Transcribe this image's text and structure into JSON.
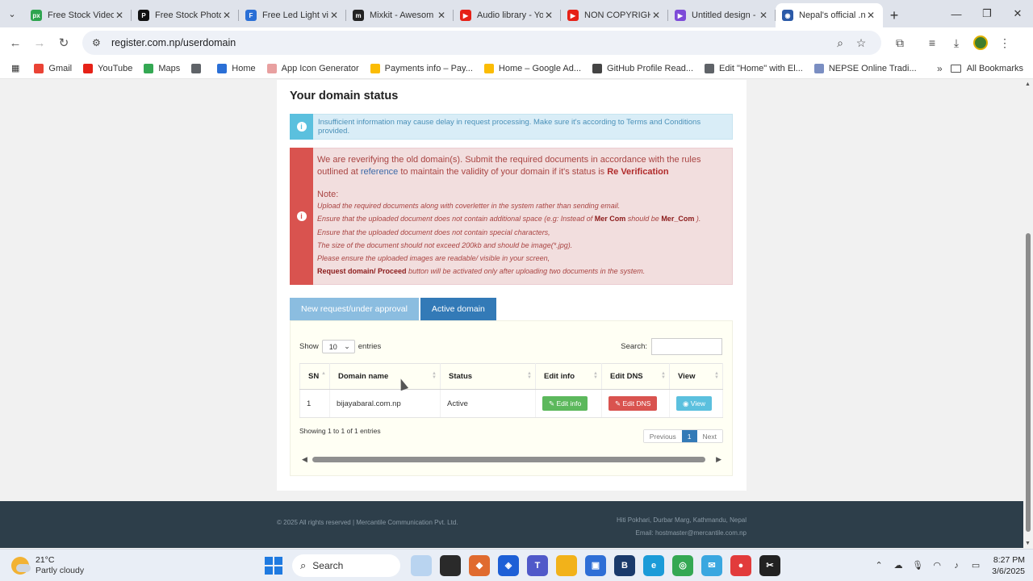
{
  "browser": {
    "tabs": [
      {
        "title": "Free Stock Video",
        "icon_color": "#2ea44f",
        "icon_glyph": "px"
      },
      {
        "title": "Free Stock Photo",
        "icon_color": "#111111",
        "icon_glyph": "P"
      },
      {
        "title": "Free Led Light vi",
        "icon_color": "#2a6fd6",
        "icon_glyph": "F"
      },
      {
        "title": "Mixkit - Awesom",
        "icon_color": "#222222",
        "icon_glyph": "m"
      },
      {
        "title": "Audio library - Yo",
        "icon_color": "#e62117",
        "icon_glyph": "▶"
      },
      {
        "title": "NON COPYRIGH",
        "icon_color": "#e62117",
        "icon_glyph": "▶"
      },
      {
        "title": "Untitled design -",
        "icon_color": "#7d4bd8",
        "icon_glyph": "▶"
      },
      {
        "title": "Nepal's official .n",
        "icon_color": "#2b5aa8",
        "icon_glyph": "◉",
        "active": true
      }
    ],
    "url": "register.com.np/userdomain",
    "bookmarks": [
      {
        "label": "Gmail",
        "icon_color": "#ea4335"
      },
      {
        "label": "YouTube",
        "icon_color": "#e62117"
      },
      {
        "label": "Maps",
        "icon_color": "#34a853"
      },
      {
        "label": "",
        "icon_color": "#5f6368"
      },
      {
        "label": "Home",
        "icon_color": "#2a6fd6"
      },
      {
        "label": "App Icon Generator",
        "icon_color": "#e8a0a0"
      },
      {
        "label": "Payments info – Pay...",
        "icon_color": "#fbbc04"
      },
      {
        "label": "Home – Google Ad...",
        "icon_color": "#fbbc04"
      },
      {
        "label": "GitHub Profile Read...",
        "icon_color": "#444444"
      },
      {
        "label": "Edit \"Home\" with El...",
        "icon_color": "#5f6368"
      },
      {
        "label": "NEPSE Online Tradi...",
        "icon_color": "#7a8ec2"
      }
    ],
    "more_label": "»",
    "all_bookmarks": "All Bookmarks"
  },
  "page": {
    "title": "Your domain status",
    "info_alert": "Insufficient information may cause delay in request processing. Make sure it's according to Terms and Conditions provided.",
    "danger_alert": {
      "main_before": "We are reverifying the old domain(s). Submit the required documents in accordance with the rules outlined at ",
      "main_link": "reference",
      "main_after": " to maintain the validity of your domain if it's status is ",
      "main_status": "Re Verification",
      "note_title": "Note:",
      "note1": "Upload the required documents along with coverletter in the system rather than sending email.",
      "note2_before": "Ensure that the uploaded document does not contain additional space (e.g: Instead of ",
      "note2_b1": "Mer Com",
      "note2_mid": " should be ",
      "note2_b2": "Mer_Com",
      "note2_after": " ).",
      "note3": "Ensure that the uploaded document does not contain special characters,",
      "note4": "The size of the document should not exceed 200kb and should be image(*.jpg).",
      "note5": "Please ensure the uploaded images are readable/ visible in your screen,",
      "note6_b": "Request domain/ Proceed",
      "note6_after": " button will be activated only after uploading two documents in the system."
    },
    "tabs": {
      "pending": "New request/under approval",
      "active": "Active domain"
    },
    "table": {
      "show": "Show",
      "page_size": "10",
      "entries": "entries",
      "search_label": "Search:",
      "columns": [
        "SN",
        "Domain name",
        "Status",
        "Edit info",
        "Edit DNS",
        "View"
      ],
      "rows": [
        {
          "sn": "1",
          "domain": "bijayabaral.com.np",
          "status": "Active",
          "edit_info": "Edit info",
          "edit_dns": "Edit DNS",
          "view": "View"
        }
      ],
      "info": "Showing 1 to 1 of 1 entries",
      "prev": "Previous",
      "page": "1",
      "next": "Next"
    }
  },
  "footer": {
    "copyright": "© 2025 All rights reserved | Mercantile Communication Pvt. Ltd.",
    "address": "Hiti Pokhari, Durbar Marg, Kathmandu, Nepal",
    "email": "Email: hostmaster@mercantile.com.np"
  },
  "taskbar": {
    "temp": "21°C",
    "weather": "Partly cloudy",
    "search": "Search",
    "time": "8:27 PM",
    "date": "3/6/2025"
  }
}
